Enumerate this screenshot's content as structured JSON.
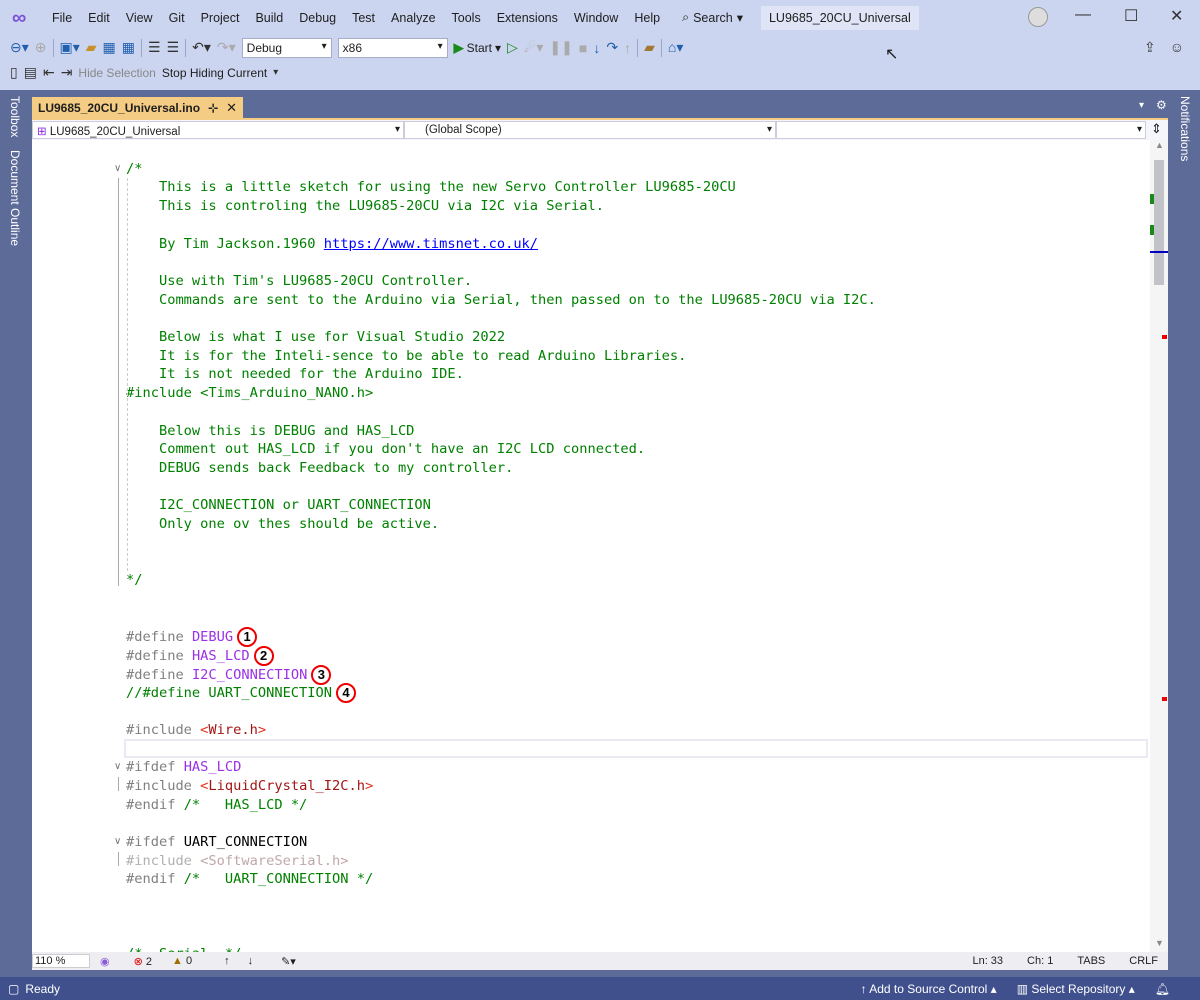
{
  "menu": [
    "File",
    "Edit",
    "View",
    "Git",
    "Project",
    "Build",
    "Debug",
    "Test",
    "Analyze",
    "Tools",
    "Extensions",
    "Window",
    "Help"
  ],
  "search_label": "Search",
  "window_title": "LU9685_20CU_Universal",
  "toolbar": {
    "config": "Debug",
    "platform": "x86",
    "start": "Start",
    "hide_selection": "Hide Selection",
    "stop_hiding": "Stop Hiding Current"
  },
  "side": {
    "toolbox": "Toolbox",
    "doc_outline": "Document Outline",
    "notifications": "Notifications"
  },
  "tab": {
    "name": "LU9685_20CU_Universal.ino",
    "pin": "⊹",
    "close": "✕"
  },
  "nav": {
    "project": "LU9685_20CU_Universal",
    "scope": "(Global Scope)",
    "member": ""
  },
  "current_line": 33,
  "lines": [
    [],
    [
      [
        "c",
        "/*"
      ]
    ],
    [
      [
        "c",
        "    This is a little sketch for using the new Servo Controller LU9685-20CU"
      ]
    ],
    [
      [
        "c",
        "    This is controling the LU9685-20CU via I2C via Serial."
      ]
    ],
    [],
    [
      [
        "c",
        "    By Tim Jackson.1960 "
      ],
      [
        "u",
        "https://www.timsnet.co.uk/"
      ]
    ],
    [],
    [
      [
        "c",
        "    Use with Tim's LU9685-20CU Controller."
      ]
    ],
    [
      [
        "c",
        "    Commands are sent to the Arduino via Serial, then passed on to the LU9685-20CU via I2C."
      ]
    ],
    [],
    [
      [
        "c",
        "    Below is what I use for Visual Studio 2022"
      ]
    ],
    [
      [
        "c",
        "    It is for the Inteli-sence to be able to read Arduino Libraries."
      ]
    ],
    [
      [
        "c",
        "    It is not needed for the Arduino IDE."
      ]
    ],
    [
      [
        "c",
        "#include <Tims_Arduino_NANO.h>"
      ]
    ],
    [],
    [
      [
        "c",
        "    Below this is DEBUG and HAS_LCD"
      ]
    ],
    [
      [
        "c",
        "    Comment out HAS_LCD if you don't have an I2C LCD connected."
      ]
    ],
    [
      [
        "c",
        "    DEBUG sends back Feedback to my controller."
      ]
    ],
    [],
    [
      [
        "c",
        "    I2C_CONNECTION or UART_CONNECTION"
      ]
    ],
    [
      [
        "c",
        "    Only one ov thes should be active."
      ]
    ],
    [],
    [],
    [
      [
        "c",
        "*/"
      ]
    ],
    [],
    [],
    [
      [
        "p",
        "#define "
      ],
      [
        "m",
        "DEBUG"
      ],
      [
        "badge",
        "1"
      ]
    ],
    [
      [
        "p",
        "#define "
      ],
      [
        "m",
        "HAS_LCD"
      ],
      [
        "badge",
        "2"
      ]
    ],
    [
      [
        "p",
        "#define "
      ],
      [
        "m",
        "I2C_CONNECTION"
      ],
      [
        "badge",
        "3"
      ]
    ],
    [
      [
        "c",
        "//#define UART_CONNECTION"
      ],
      [
        "badge",
        "4"
      ]
    ],
    [],
    [
      [
        "p",
        "#include "
      ],
      [
        "a",
        "<"
      ],
      [
        "s",
        "Wire.h"
      ],
      [
        "a",
        ">"
      ]
    ],
    [],
    [
      [
        "p",
        "#ifdef "
      ],
      [
        "m",
        "HAS_LCD"
      ]
    ],
    [
      [
        "p",
        "#include "
      ],
      [
        "a",
        "<"
      ],
      [
        "s",
        "LiquidCrystal_I2C.h"
      ],
      [
        "a",
        ">"
      ]
    ],
    [
      [
        "p",
        "#endif "
      ],
      [
        "c",
        "/*   HAS_LCD */"
      ]
    ],
    [],
    [
      [
        "p",
        "#ifdef "
      ],
      [
        "k",
        "UART_CONNECTION"
      ]
    ],
    [
      [
        "dp",
        "#include "
      ],
      [
        "d",
        "<SoftwareSerial.h>"
      ]
    ],
    [
      [
        "p",
        "#endif "
      ],
      [
        "c",
        "/*   UART_CONNECTION */"
      ]
    ],
    [],
    [],
    [],
    [
      [
        "c",
        "/*  Serial  */"
      ]
    ]
  ],
  "bottom": {
    "zoom": "110 %",
    "errors": "2",
    "warnings": "0",
    "ln": "Ln: 33",
    "ch": "Ch: 1",
    "tabs": "TABS",
    "eol": "CRLF"
  },
  "status": {
    "ready": "Ready",
    "source_control": "Add to Source Control",
    "repo": "Select Repository"
  }
}
